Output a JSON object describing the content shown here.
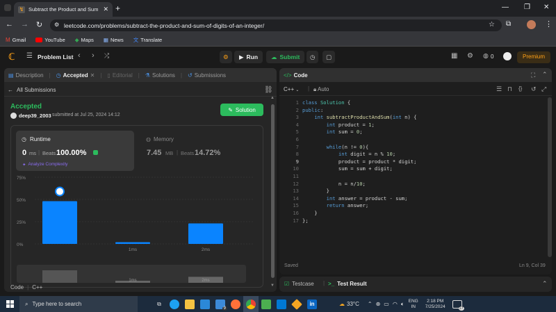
{
  "browser": {
    "tab_title": "Subtract the Product and Sum",
    "url": "leetcode.com/problems/subtract-the-product-and-sum-of-digits-of-an-integer/",
    "bookmarks": [
      "Gmail",
      "YouTube",
      "Maps",
      "News",
      "Translate"
    ]
  },
  "header": {
    "problem_list": "Problem List",
    "run": "Run",
    "submit": "Submit",
    "streak": "0",
    "premium": "Premium"
  },
  "left": {
    "tabs": [
      "Description",
      "Accepted",
      "Editorial",
      "Solutions",
      "Submissions"
    ],
    "back": "All Submissions",
    "status": "Accepted",
    "user": "deep39_2003",
    "submitted": "submitted at Jul 25, 2024 14:12",
    "solution_btn": "Solution",
    "runtime": {
      "title": "Runtime",
      "value": "0",
      "unit": "ms",
      "beats_label": "Beats",
      "beats": "100.00%",
      "analyze": "Analyze Complexity"
    },
    "memory": {
      "title": "Memory",
      "value": "7.45",
      "unit": "MB",
      "beats_label": "Beats",
      "beats": "14.72%"
    },
    "footer": {
      "code": "Code",
      "lang": "C++"
    }
  },
  "chart_data": {
    "type": "bar",
    "categories": [
      "0ms",
      "1ms",
      "2ms"
    ],
    "values": [
      48,
      2,
      23
    ],
    "yticks": [
      "75%",
      "50%",
      "25%",
      "0%"
    ],
    "ylim": [
      0,
      75
    ],
    "xlabels": [
      "",
      "1ms",
      "2ms"
    ],
    "mini_labels": [
      "",
      "1ms",
      "2ms"
    ],
    "mini_values": [
      48,
      2,
      23
    ]
  },
  "editor": {
    "title": "Code",
    "lang": "C++",
    "mode": "Auto",
    "saved": "Saved",
    "cursor": "Ln 9, Col 39",
    "lines": [
      "class Solution {",
      "public:",
      "    int subtractProductAndSum(int n) {",
      "        int product = 1;",
      "        int sum = 0;",
      "",
      "        while(n != 0){",
      "            int digit = n % 10;",
      "            product = product * digit;",
      "            sum = sum + digit;",
      "",
      "            n = n/10;",
      "        }",
      "        int answer = product - sum;",
      "        return answer;",
      "    }",
      "};"
    ]
  },
  "console": {
    "testcase": "Testcase",
    "result": "Test Result"
  },
  "taskbar": {
    "search": "Type here to search",
    "weather": "33°C",
    "lang1": "ENG",
    "lang2": "IN",
    "time": "2:18 PM",
    "date": "7/25/2024",
    "notif": "17",
    "badge": "9"
  }
}
